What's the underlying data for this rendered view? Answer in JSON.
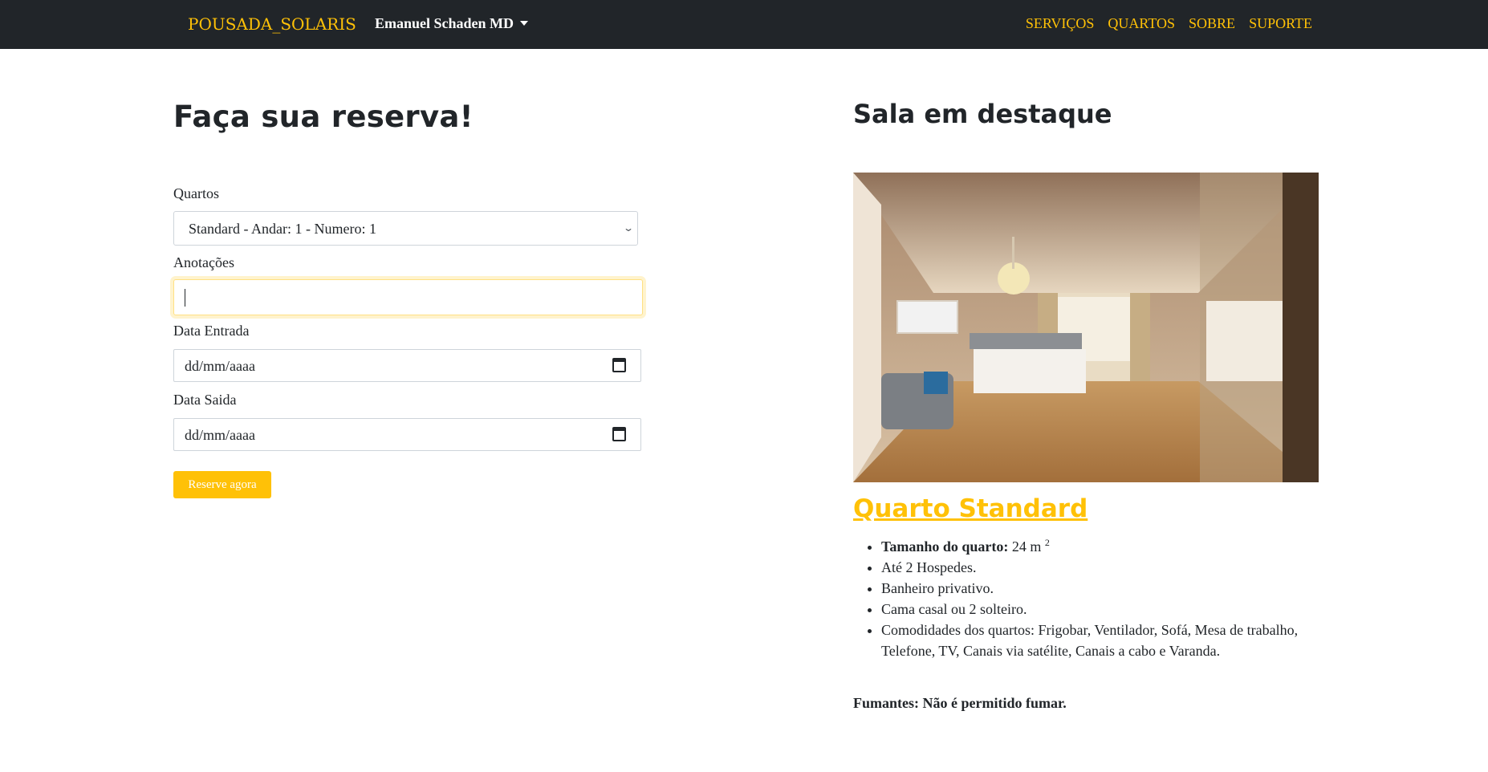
{
  "navbar": {
    "brand": "POUSADA_SOLARIS",
    "user": "Emanuel Schaden MD",
    "links": [
      "SERVIÇOS",
      "QUARTOS",
      "SOBRE",
      "SUPORTE"
    ]
  },
  "reservation": {
    "heading": "Faça sua reserva!",
    "rooms_label": "Quartos",
    "rooms_selected": "Standard - Andar: 1 - Numero: 1",
    "notes_label": "Anotações",
    "notes_value": "",
    "checkin_label": "Data Entrada",
    "checkin_value": "dd/mm/aaaa",
    "checkout_label": "Data Saida",
    "checkout_value": "dd/mm/aaaa",
    "submit_label": "Reserve agora"
  },
  "featured": {
    "heading": "Sala em destaque",
    "room_title": "Quarto Standard",
    "size_label": "Tamanho do quarto:",
    "size_value": "24 m",
    "size_sup": "2",
    "features": [
      "Até 2 Hospedes.",
      "Banheiro privativo.",
      "Cama casal ou 2 solteiro.",
      "Comodidades dos quartos: Frigobar, Ventilador, Sofá, Mesa de trabalho, Telefone, TV, Canais via satélite, Canais a cabo e Varanda."
    ],
    "smoking_note": "Fumantes: Não é permitido fumar."
  },
  "colors": {
    "navbar_bg": "#212529",
    "accent": "#ffc107",
    "text": "#212529"
  },
  "icons": {
    "dropdown": "chevron-down-icon",
    "date": "calendar-icon"
  }
}
